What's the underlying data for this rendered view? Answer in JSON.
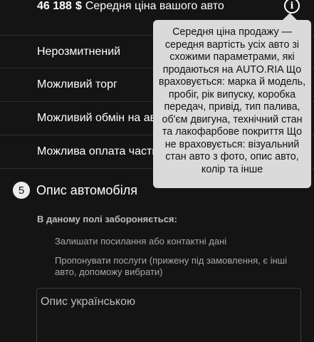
{
  "price": {
    "amount": "46 188",
    "currency": "$",
    "label": "Середня ціна вашого авто",
    "info_icon": "info-icon"
  },
  "options": [
    "Нерозмитнений",
    "Можливий торг",
    "Можливий обмін на авто",
    "Можлива оплата частинами"
  ],
  "tooltip": {
    "text": "Середня ціна продажу — середня вартість усіх авто зі схожими параметрами, які продаються на AUTO.RIA Що враховується: марка й модель, пробіг, рік випуску, коробка передач, привід, тип палива, об'єм двигуна, технічний стан та лакофарбове покриття Що не враховується: візуальний стан авто з фото, опис авто, колір та інше"
  },
  "description_section": {
    "step": "5",
    "title": "Опис автомобіля",
    "rules_title": "В даному полі забороняється:",
    "rules": [
      "Залишати посилання або контактні дані",
      "Пропонувати послуги (прижену під замовлення, є інші авто, допоможу вибрати)"
    ],
    "textarea_placeholder": "Опис українською"
  }
}
